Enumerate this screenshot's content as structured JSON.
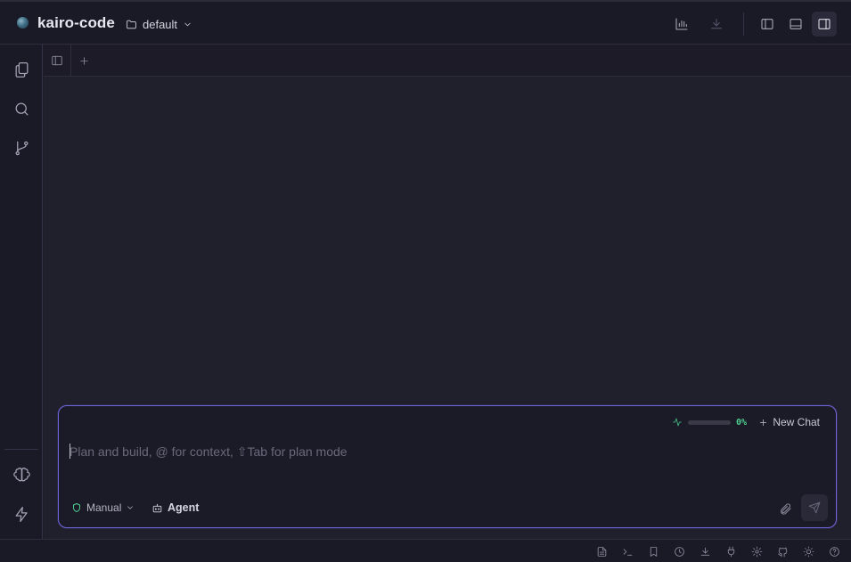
{
  "header": {
    "app_title": "kairo-code",
    "workspace": "default",
    "buttons": [
      {
        "name": "analytics",
        "icon": "bar-chart-icon"
      },
      {
        "name": "download",
        "icon": "download-icon"
      },
      {
        "name": "toggle-left-panel",
        "icon": "sidebar-left-icon"
      },
      {
        "name": "toggle-bottom-panel",
        "icon": "panel-bottom-icon"
      },
      {
        "name": "toggle-right-panel",
        "icon": "sidebar-right-icon",
        "active": true
      }
    ]
  },
  "activity_bar": {
    "items": [
      "files-icon",
      "search-icon",
      "git-branch-icon",
      "brain-icon",
      "zap-icon"
    ]
  },
  "editor": {
    "tab_actions": [
      "sidebar-toggle-icon",
      "plus-icon"
    ]
  },
  "chat": {
    "context_usage": "0%",
    "new_chat_label": "New Chat",
    "placeholder": "Plan and build, @ for context, ⇧Tab for plan mode",
    "input_value": "",
    "approval_mode": "Manual",
    "agent_label": "Agent"
  },
  "status_bar": {
    "icons": [
      "file-text-icon",
      "terminal-icon",
      "bookmark-icon",
      "history-icon",
      "download-icon",
      "plug-icon",
      "settings-icon",
      "github-icon",
      "sun-icon",
      "help-icon"
    ]
  },
  "colors": {
    "accent": "#6f67d9",
    "success": "#4fd08f",
    "background": "#1c1b26"
  }
}
